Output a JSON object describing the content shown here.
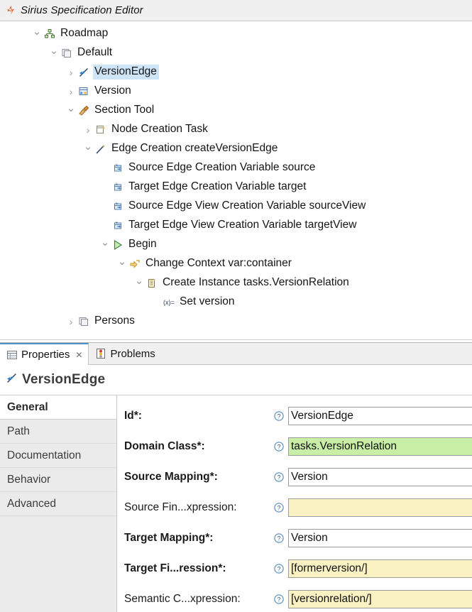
{
  "editor": {
    "tab_label": "Sirius Specification Editor",
    "tab_icon": "sirius-icon"
  },
  "tree": {
    "rows": [
      {
        "label": "Roadmap",
        "indent": 1,
        "arrow": "expanded",
        "icon": "viewpoint-icon",
        "selected": false
      },
      {
        "label": "Default",
        "indent": 2,
        "arrow": "expanded",
        "icon": "diagram-icon",
        "selected": false
      },
      {
        "label": "VersionEdge",
        "indent": 3,
        "arrow": "collapsed",
        "icon": "edge-mapping-icon",
        "selected": true
      },
      {
        "label": "Version",
        "indent": 3,
        "arrow": "collapsed",
        "icon": "node-mapping-icon",
        "selected": false
      },
      {
        "label": "Section Tool",
        "indent": 3,
        "arrow": "expanded",
        "icon": "tool-section-icon",
        "selected": false
      },
      {
        "label": "Node Creation Task",
        "indent": 4,
        "arrow": "collapsed",
        "icon": "node-creation-icon",
        "selected": false
      },
      {
        "label": "Edge Creation createVersionEdge",
        "indent": 4,
        "arrow": "expanded",
        "icon": "edge-creation-icon",
        "selected": false
      },
      {
        "label": "Source Edge Creation Variable source",
        "indent": 5,
        "arrow": "none",
        "icon": "variable-icon",
        "selected": false
      },
      {
        "label": "Target Edge Creation Variable target",
        "indent": 5,
        "arrow": "none",
        "icon": "variable-icon",
        "selected": false
      },
      {
        "label": "Source Edge View Creation Variable sourceView",
        "indent": 5,
        "arrow": "none",
        "icon": "variable-icon",
        "selected": false
      },
      {
        "label": "Target Edge View Creation Variable targetView",
        "indent": 5,
        "arrow": "none",
        "icon": "variable-icon",
        "selected": false
      },
      {
        "label": "Begin",
        "indent": 5,
        "arrow": "expanded",
        "icon": "begin-icon",
        "selected": false
      },
      {
        "label": "Change Context var:container",
        "indent": 6,
        "arrow": "expanded",
        "icon": "change-context-icon",
        "selected": false
      },
      {
        "label": "Create Instance tasks.VersionRelation",
        "indent": 7,
        "arrow": "expanded",
        "icon": "create-instance-icon",
        "selected": false
      },
      {
        "label": "Set version",
        "indent": 8,
        "arrow": "none",
        "icon": "set-value-icon",
        "selected": false
      },
      {
        "label": "Persons",
        "indent": 3,
        "arrow": "collapsed",
        "icon": "diagram-icon",
        "selected": false
      }
    ]
  },
  "view_tabs": [
    {
      "label": "Properties",
      "icon": "properties-icon",
      "active": true,
      "close_label": "✕"
    },
    {
      "label": "Problems",
      "icon": "problems-icon",
      "active": false,
      "close_label": ""
    }
  ],
  "properties": {
    "title": "VersionEdge",
    "title_icon": "edge-mapping-icon",
    "tabs": [
      {
        "label": "General",
        "active": true
      },
      {
        "label": "Path",
        "active": false
      },
      {
        "label": "Documentation",
        "active": false
      },
      {
        "label": "Behavior",
        "active": false
      },
      {
        "label": "Advanced",
        "active": false
      }
    ],
    "fields": [
      {
        "label": "Id*:",
        "required": true,
        "value": "VersionEdge",
        "style": "plain"
      },
      {
        "label": "Domain Class*:",
        "required": true,
        "value": "tasks.VersionRelation",
        "style": "green"
      },
      {
        "label": "Source Mapping*:",
        "required": true,
        "value": "Version",
        "style": "plain"
      },
      {
        "label": "Source Fin...xpression:",
        "required": false,
        "value": "",
        "style": "yellow"
      },
      {
        "label": "Target Mapping*:",
        "required": true,
        "value": "Version",
        "style": "plain"
      },
      {
        "label": "Target Fi...ression*:",
        "required": true,
        "value": "[formerversion/]",
        "style": "yellow"
      },
      {
        "label": "Semantic C...xpression:",
        "required": false,
        "value": "[versionrelation/]",
        "style": "yellow"
      }
    ],
    "help_icon": "help-icon"
  },
  "colors": {
    "selection": "#cde5f7",
    "valid_green": "#c9eea5",
    "expression_yellow": "#fbf2c3",
    "accent_orange": "#e8622a",
    "tab_accent": "#4a90c4"
  }
}
